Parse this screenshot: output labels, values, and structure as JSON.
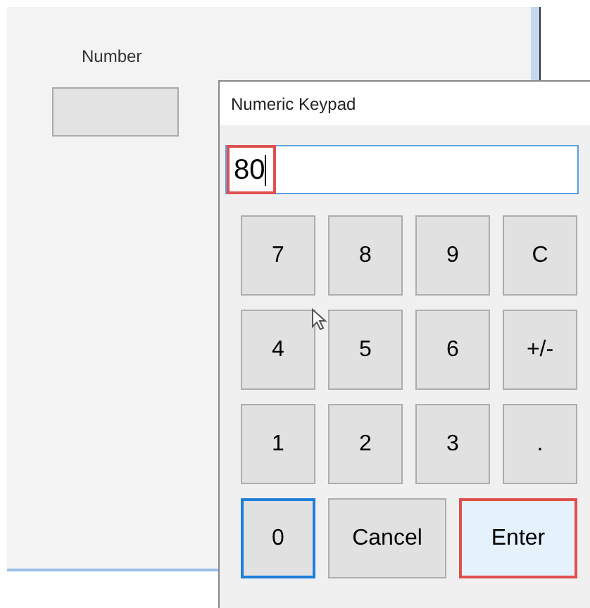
{
  "main_window": {
    "number_label": "Number"
  },
  "dialog": {
    "title": "Numeric Keypad",
    "display": {
      "value": "80",
      "annotated": true
    },
    "rows": [
      [
        {
          "label": "7",
          "focused": false
        },
        {
          "label": "8",
          "focused": false
        },
        {
          "label": "9",
          "focused": false
        },
        {
          "label": "C",
          "focused": false
        }
      ],
      [
        {
          "label": "4",
          "focused": false
        },
        {
          "label": "5",
          "focused": false
        },
        {
          "label": "6",
          "focused": false
        },
        {
          "label": "+/-",
          "focused": false
        }
      ],
      [
        {
          "label": "1",
          "focused": false
        },
        {
          "label": "2",
          "focused": false
        },
        {
          "label": "3",
          "focused": false
        },
        {
          "label": ".",
          "focused": false
        }
      ]
    ],
    "bottom_keys": [
      {
        "label": "0",
        "kind": "square",
        "focused": true,
        "hovered": false,
        "annotated": false
      },
      {
        "label": "Cancel",
        "kind": "wide",
        "focused": false,
        "hovered": false,
        "annotated": false
      },
      {
        "label": "Enter",
        "kind": "wide",
        "focused": false,
        "hovered": true,
        "annotated": true
      }
    ]
  }
}
